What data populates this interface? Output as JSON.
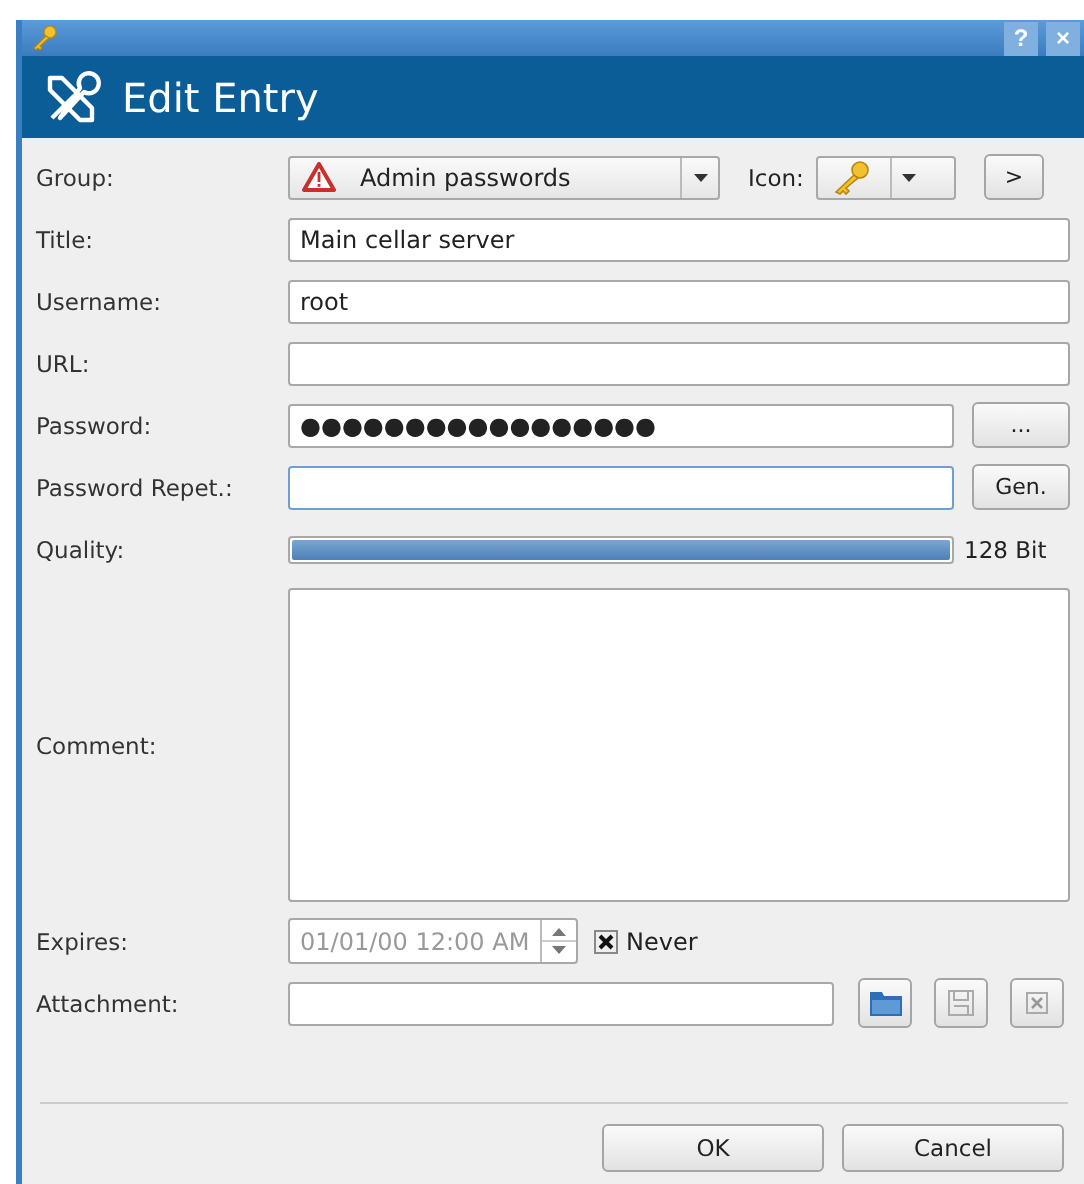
{
  "window": {
    "title_buttons": [
      "?",
      "×"
    ]
  },
  "header": {
    "title": "Edit Entry"
  },
  "group": {
    "label": "Group:",
    "value": "Admin passwords"
  },
  "icon": {
    "label": "Icon:",
    "next": ">"
  },
  "fields": [
    {
      "kind": "text",
      "label": "Title:",
      "value": "Main cellar server"
    },
    {
      "kind": "text",
      "label": "Username:",
      "value": "root"
    },
    {
      "kind": "text",
      "label": "URL:"
    },
    {
      "kind": "password",
      "label": "Password:",
      "value": "●●●●●●●●●●●●●●●●●",
      "button": "..."
    },
    {
      "kind": "password",
      "label": "Password Repet.:",
      "focused": true,
      "button": "Gen."
    }
  ],
  "quality": {
    "label": "Quality:",
    "level": 1.0,
    "reading": "128 Bit"
  },
  "comment": {
    "label": "Comment:"
  },
  "expires": {
    "label": "Expires:",
    "value": "01/01/00 12:00 AM",
    "disabled": true,
    "never": {
      "label": "Never",
      "checked": true
    }
  },
  "attachment": {
    "label": "Attachment:"
  },
  "buttons": [
    "OK",
    "Cancel"
  ]
}
